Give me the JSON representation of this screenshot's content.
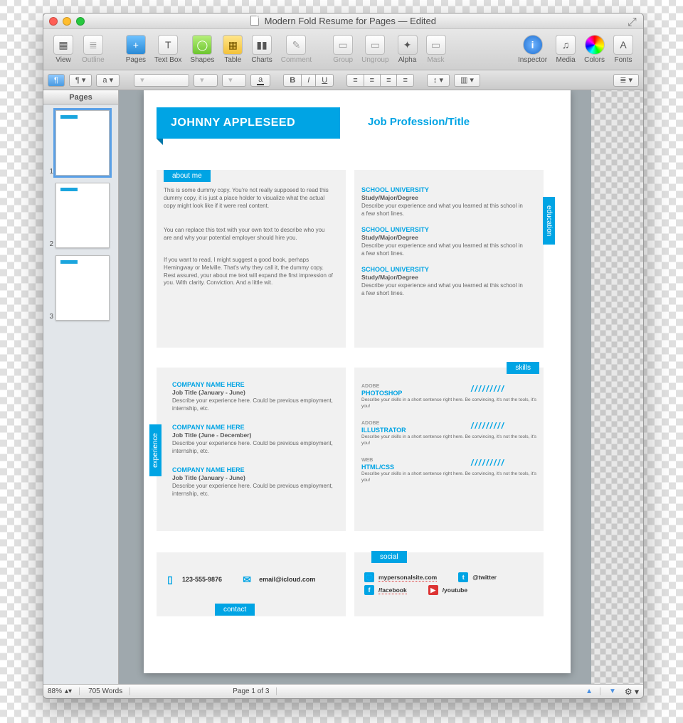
{
  "window": {
    "title": "Modern Fold Resume for Pages",
    "subtitle": "Edited"
  },
  "toolbar": [
    {
      "id": "view",
      "label": "View",
      "icon": "▦",
      "disabled": false
    },
    {
      "id": "outline",
      "label": "Outline",
      "icon": "≣",
      "disabled": true
    },
    {
      "id": "gap"
    },
    {
      "id": "pages",
      "label": "Pages",
      "icon": "+",
      "cls": "pages",
      "disabled": false
    },
    {
      "id": "textbox",
      "label": "Text Box",
      "icon": "T",
      "disabled": false
    },
    {
      "id": "shapes",
      "label": "Shapes",
      "icon": "◯",
      "cls": "shapes",
      "disabled": false
    },
    {
      "id": "table",
      "label": "Table",
      "icon": "▦",
      "cls": "table",
      "disabled": false
    },
    {
      "id": "charts",
      "label": "Charts",
      "icon": "▮▮",
      "disabled": false
    },
    {
      "id": "comment",
      "label": "Comment",
      "icon": "✎",
      "disabled": true
    },
    {
      "id": "gap"
    },
    {
      "id": "group",
      "label": "Group",
      "icon": "▭",
      "disabled": true
    },
    {
      "id": "ungroup",
      "label": "Ungroup",
      "icon": "▭",
      "disabled": true
    },
    {
      "id": "alpha",
      "label": "Alpha",
      "icon": "✦",
      "cls": "alpha",
      "disabled": false
    },
    {
      "id": "mask",
      "label": "Mask",
      "icon": "▭",
      "disabled": true
    },
    {
      "id": "flex"
    },
    {
      "id": "inspector",
      "label": "Inspector",
      "icon": "i",
      "cls": "info",
      "disabled": false
    },
    {
      "id": "media",
      "label": "Media",
      "icon": "♫",
      "disabled": false
    },
    {
      "id": "colors",
      "label": "Colors",
      "icon": "",
      "cls": "colors",
      "disabled": false
    },
    {
      "id": "fonts",
      "label": "Fonts",
      "icon": "A",
      "disabled": false
    }
  ],
  "formatbar": {
    "para_style": "¶",
    "list_style": "a",
    "bold": "B",
    "italic": "I",
    "underline": "U",
    "sample": "a"
  },
  "sidebar": {
    "header": "Pages",
    "thumbs": [
      1,
      2,
      3
    ],
    "active": 1
  },
  "resume": {
    "name": "JOHNNY APPLESEED",
    "job": "Job Profession/Title",
    "section_labels": {
      "about": "about me",
      "education": "education",
      "experience": "experience",
      "skills": "skills",
      "social": "social",
      "contact": "contact"
    },
    "about": [
      "This is some dummy copy. You're not really supposed to read this dummy copy, it is just a place holder to visualize what the actual copy might look like if it were real content.",
      "You can replace this text with your own text to describe who you are and why your potential employer should hire you.",
      "If you want to read, I might suggest a good book, perhaps Hemingway or Melville. That's why they call it, the dummy copy. Rest assured, your about me text will expand the first impression of you. With clarity. Conviction. And a little wit."
    ],
    "education": [
      {
        "school": "SCHOOL UNIVERSITY",
        "degree": "Study/Major/Degree",
        "desc": "Describe your experience and what you learned at this school in a few short lines."
      },
      {
        "school": "SCHOOL UNIVERSITY",
        "degree": "Study/Major/Degree",
        "desc": "Describe your experience and what you learned at this school in a few short lines."
      },
      {
        "school": "SCHOOL UNIVERSITY",
        "degree": "Study/Major/Degree",
        "desc": "Describe your experience and what you learned at this school in a few short lines."
      }
    ],
    "experience": [
      {
        "company": "COMPANY NAME HERE",
        "role": "Job Title (January - June)",
        "desc": "Describe your experience here. Could be previous employment, internship, etc."
      },
      {
        "company": "COMPANY NAME HERE",
        "role": "Job Title (June - December)",
        "desc": "Describe your experience here. Could be previous employment, internship, etc."
      },
      {
        "company": "COMPANY NAME HERE",
        "role": "Job Title (January - June)",
        "desc": "Describe your experience here. Could be previous employment, internship, etc."
      }
    ],
    "skills": [
      {
        "cat": "ADOBE",
        "name": "PHOTOSHOP",
        "desc": "Describe your skills in a short sentence right here. Be convincing, it's not the tools, it's you!"
      },
      {
        "cat": "ADOBE",
        "name": "ILLUSTRATOR",
        "desc": "Describe your skills in a short sentence right here. Be convincing, it's not the tools, it's you!"
      },
      {
        "cat": "WEB",
        "name": "HTML/CSS",
        "desc": "Describe your skills in a short sentence right here. Be convincing, it's not the tools, it's you!"
      }
    ],
    "skill_bars": "/////////",
    "contact": {
      "phone": "123-555-9876",
      "email": "email@icloud.com"
    },
    "social": {
      "site": "mypersonalsite.com",
      "twitter": "@twitter",
      "facebook": "/facebook",
      "youtube": "/youtube"
    }
  },
  "status": {
    "zoom": "88%",
    "words": "705 Words",
    "page": "Page 1 of 3"
  }
}
